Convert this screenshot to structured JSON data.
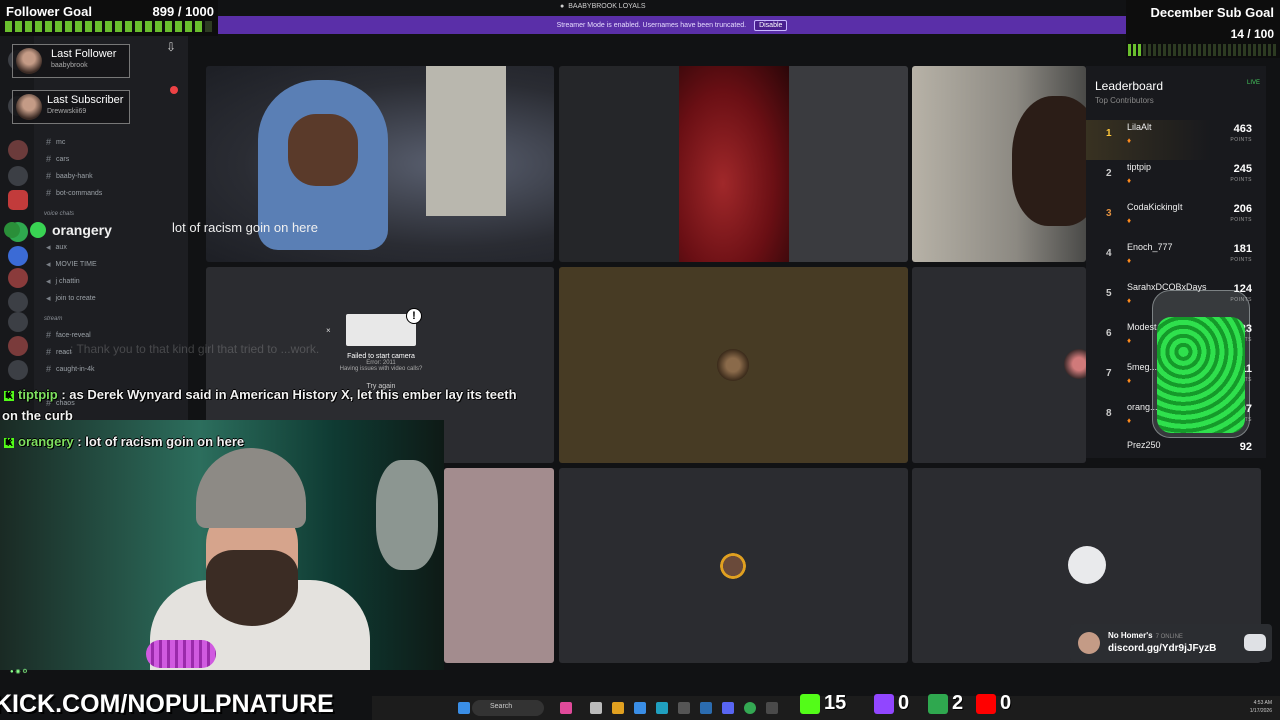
{
  "follower_goal": {
    "title": "Follower Goal",
    "count": "899 / 1000"
  },
  "sub_goal": {
    "title": "December Sub Goal",
    "count": "14 / 100"
  },
  "banner": {
    "text": "Streamer Mode is enabled. Usernames have been truncated.",
    "button": "Disable"
  },
  "server_name_top": "BAABYBROOK LOYALS",
  "sidebar": {
    "server_name": "BAABYBROOK LOYALS",
    "last_follower": {
      "label": "Last Follower",
      "name": "baabybrook"
    },
    "last_subscriber": {
      "label": "Last Subscriber",
      "name": "Drewwskii69"
    },
    "channels": [
      "mc",
      "cars",
      "baaby-hank",
      "bot-commands"
    ],
    "voice_category": "voice chats",
    "voice_channels": [
      "aux",
      "MOVIE TIME",
      "j chattin",
      "join to create"
    ],
    "stream_category": "stream",
    "stream_channels": [
      "face-reveal",
      "react",
      "caught-in-4k",
      "chaos"
    ]
  },
  "speaker": {
    "name": "orangery",
    "speech": "lot of racism goin on here"
  },
  "camera_error": {
    "title": "Failed to start camera",
    "code": "Error: 2011",
    "help": "Having issues with video calls?",
    "retry": "Try again"
  },
  "chat": {
    "faded_line": "...: Thank you to that kind girl that tried to ...work.",
    "messages": [
      {
        "user": "tiptpip",
        "text": ": as Derek Wynyard said in American History X, let this ember lay its teeth"
      },
      {
        "user": "",
        "text": "on the curb"
      },
      {
        "user": "orangery",
        "text": ": lot of racism goin on here"
      }
    ]
  },
  "leaderboard": {
    "title": "Leaderboard",
    "subtitle": "Top Contributors",
    "live": "LIVE",
    "points_label": "POINTS",
    "entries": [
      {
        "rank": "1",
        "name": "LilaAlt",
        "points": "463"
      },
      {
        "rank": "2",
        "name": "tiptpip",
        "points": "245"
      },
      {
        "rank": "3",
        "name": "CodaKickingIt",
        "points": "206"
      },
      {
        "rank": "4",
        "name": "Enoch_777",
        "points": "181"
      },
      {
        "rank": "5",
        "name": "SarahxDCOBxDays",
        "points": "124"
      },
      {
        "rank": "6",
        "name": "Modest...",
        "points": "123"
      },
      {
        "rank": "7",
        "name": "5meg...",
        "points": "111"
      },
      {
        "rank": "8",
        "name": "orang...",
        "points": "97"
      },
      {
        "rank": "",
        "name": "Prez250",
        "points": "92"
      }
    ]
  },
  "discord_invite": {
    "name": "No Homer's",
    "online": "7 ONLINE",
    "url": "discord.gg/Ydr9jJFyzB"
  },
  "kick_url": "KICK.COM/NOPULPNATURE",
  "stats": {
    "kick": "15",
    "twitch": "0",
    "other": "2",
    "youtube": "0"
  },
  "taskbar": {
    "search": "Search",
    "time": "4:53 AM",
    "date": "1/17/2026"
  },
  "colors": {
    "kick_green": "#53fc18",
    "twitch_purple": "#9146ff",
    "youtube_red": "#ff0000",
    "banner_purple": "#5a2fa8"
  }
}
